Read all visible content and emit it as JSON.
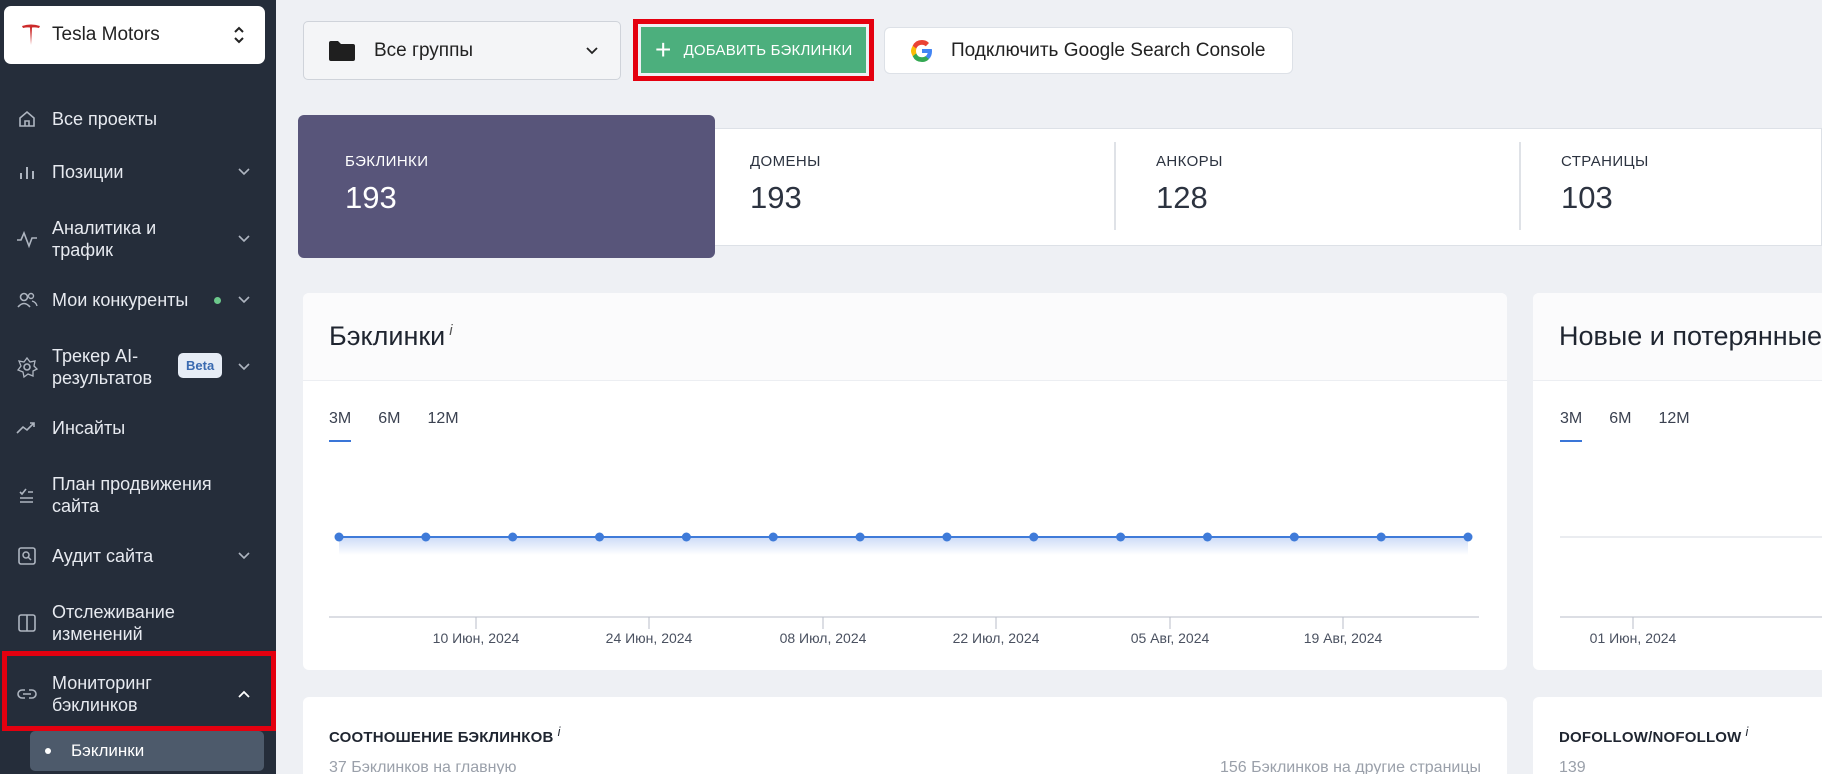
{
  "project": {
    "name": "Tesla Motors",
    "logo_icon": "tesla-logo-icon",
    "logo_color": "#cc2a2a"
  },
  "sidebar": {
    "items": [
      {
        "label": "Все проекты",
        "icon": "home-icon"
      },
      {
        "label": "Позиции",
        "icon": "bar-chart-icon"
      },
      {
        "label": "Аналитика и трафик",
        "icon": "pulse-icon"
      },
      {
        "label": "Мои конкуренты",
        "icon": "users-icon"
      },
      {
        "label": "Трекер AI-результатов",
        "icon": "ai-icon",
        "badge": "Beta"
      },
      {
        "label": "Инсайты",
        "icon": "trend-icon"
      },
      {
        "label": "План продвижения сайта",
        "icon": "checklist-icon"
      },
      {
        "label": "Аудит сайта",
        "icon": "audit-icon"
      },
      {
        "label": "Отслеживание изменений",
        "icon": "book-icon"
      },
      {
        "label": "Мониторинг бэклинков",
        "icon": "link-icon"
      }
    ],
    "subitem": "Бэклинки"
  },
  "toolbar": {
    "group_select": "Все группы",
    "add_button": "ДОБАВИТЬ БЭКЛИНКИ",
    "gsc_button": "Подключить Google Search Console"
  },
  "stats": [
    {
      "label": "БЭКЛИНКИ",
      "value": "193"
    },
    {
      "label": "ДОМЕНЫ",
      "value": "193"
    },
    {
      "label": "АНКОРЫ",
      "value": "128"
    },
    {
      "label": "СТРАНИЦЫ",
      "value": "103"
    }
  ],
  "backlinks_card": {
    "title": "Бэклинки",
    "info": "i",
    "tabs": [
      "3M",
      "6M",
      "12M"
    ]
  },
  "new_lost_card": {
    "title": "Новые и потерянные",
    "tabs": [
      "3M",
      "6M",
      "12M"
    ]
  },
  "ratio_card": {
    "title": "СООТНОШЕНИЕ БЭКЛИНКОВ",
    "info": "i",
    "left_note": "37 Бэклинков на главную",
    "right_note": "156 Бэклинков на другие страницы"
  },
  "dofollow_card": {
    "title": "DOFOLLOW/NOFOLLOW",
    "info": "i",
    "value": "139"
  },
  "chart_data": [
    {
      "type": "line",
      "title": "Бэклинки",
      "x_ticks": [
        "10 Июн, 2024",
        "24 Июн, 2024",
        "08 Июл, 2024",
        "22 Июл, 2024",
        "05 Авг, 2024",
        "19 Авг, 2024"
      ],
      "points": 14,
      "values": [
        193,
        193,
        193,
        193,
        193,
        193,
        193,
        193,
        193,
        193,
        193,
        193,
        193,
        193
      ],
      "color": "#3f7bd9"
    },
    {
      "type": "line",
      "title": "Новые и потерянные",
      "x_ticks": [
        "01 Июн, 2024"
      ]
    }
  ]
}
